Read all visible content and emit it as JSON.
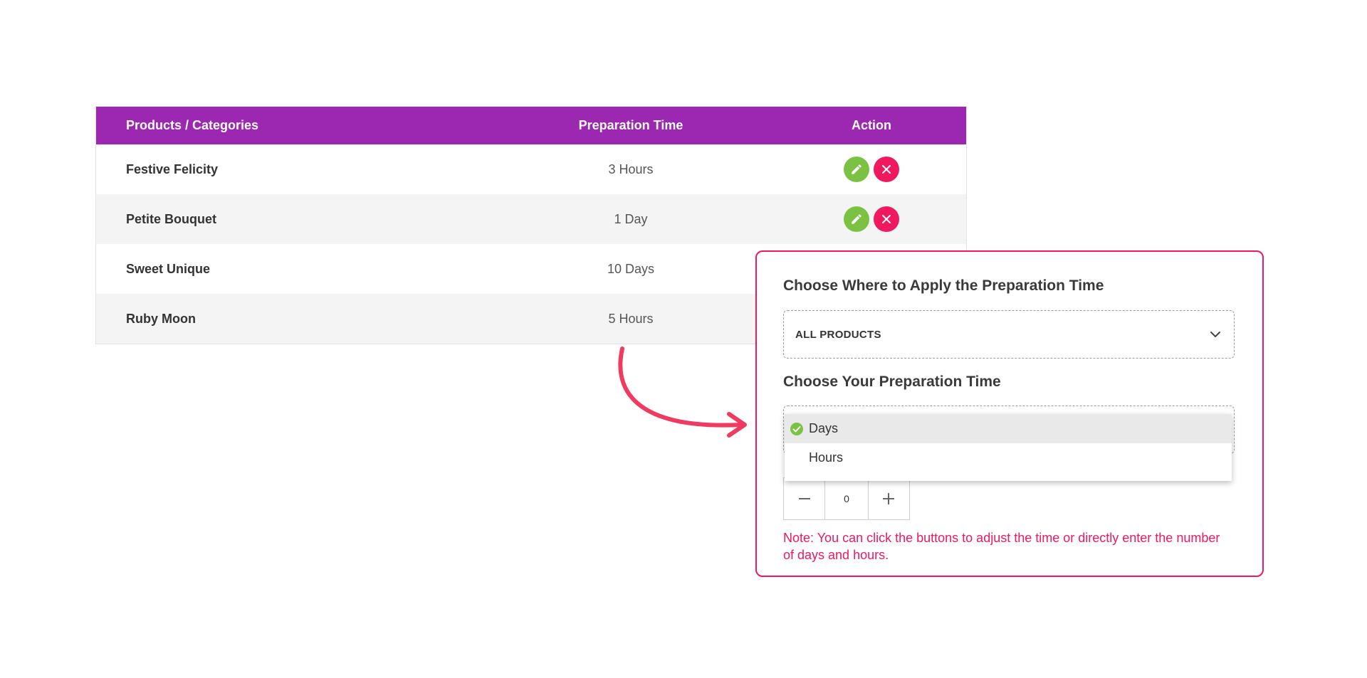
{
  "table": {
    "headers": [
      "Products / Categories",
      "Preparation Time",
      "Action"
    ],
    "rows": [
      {
        "name": "Festive Felicity",
        "time": "3 Hours"
      },
      {
        "name": "Petite Bouquet",
        "time": "1 Day"
      },
      {
        "name": "Sweet Unique",
        "time": "10 Days"
      },
      {
        "name": "Ruby Moon",
        "time": "5 Hours"
      }
    ],
    "header_color": "#9c27b0",
    "edit_color": "#7cc242",
    "delete_color": "#f0185f",
    "edit_icon": "pencil-icon",
    "delete_icon": "close-icon"
  },
  "panel": {
    "apply_heading": "Choose Where to Apply the Preparation Time",
    "apply_value": "ALL PRODUCTS",
    "time_heading": "Choose Your Preparation Time",
    "unit_options": [
      {
        "label": "Days",
        "selected": true
      },
      {
        "label": "Hours",
        "selected": false
      }
    ],
    "stepper_value": "0",
    "note": "Note: You can click the buttons to adjust the time or directly enter the number of days and hours.",
    "accent_color": "#f0185f"
  }
}
